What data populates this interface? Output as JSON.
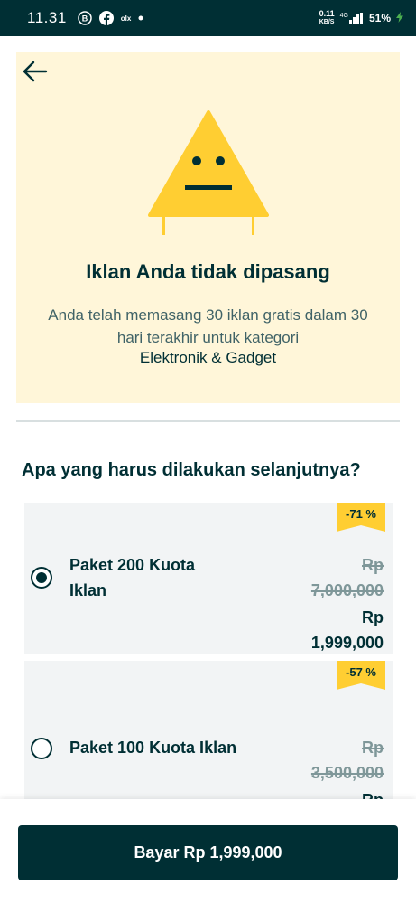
{
  "status_bar": {
    "time": "11.31",
    "icons": [
      "b-badge-icon",
      "facebook-icon",
      "olx-icon",
      "dot-icon"
    ],
    "olx_label": "olx",
    "net_speed_value": "0.11",
    "net_speed_unit": "KB/S",
    "signal_label": "4G",
    "battery": "51%"
  },
  "hero": {
    "title": "Iklan Anda tidak dipasang",
    "description": "Anda telah memasang 30 iklan gratis dalam 30 hari terakhir untuk kategori",
    "category": "Elektronik & Gadget",
    "colors": {
      "background": "#fff6d9",
      "sign": "#ffce32"
    }
  },
  "question": "Apa yang harus dilakukan selanjutnya?",
  "packages": [
    {
      "name_line1": "Paket 200 Kuota",
      "name_line2": "Iklan",
      "discount": "-71 %",
      "old_currency": "Rp",
      "old_price": "7,000,000",
      "new_currency": "Rp",
      "new_price": "1,999,000",
      "selected": true
    },
    {
      "name_line1": "Paket 100 Kuota Iklan",
      "discount": "-57 %",
      "old_currency": "Rp",
      "old_price": "3,500,000",
      "new_currency": "Rp",
      "selected": false
    }
  ],
  "pay_button": "Bayar Rp 1,999,000",
  "colors": {
    "primary": "#002f34",
    "accent": "#ffce32",
    "card": "#f2f4f5"
  }
}
